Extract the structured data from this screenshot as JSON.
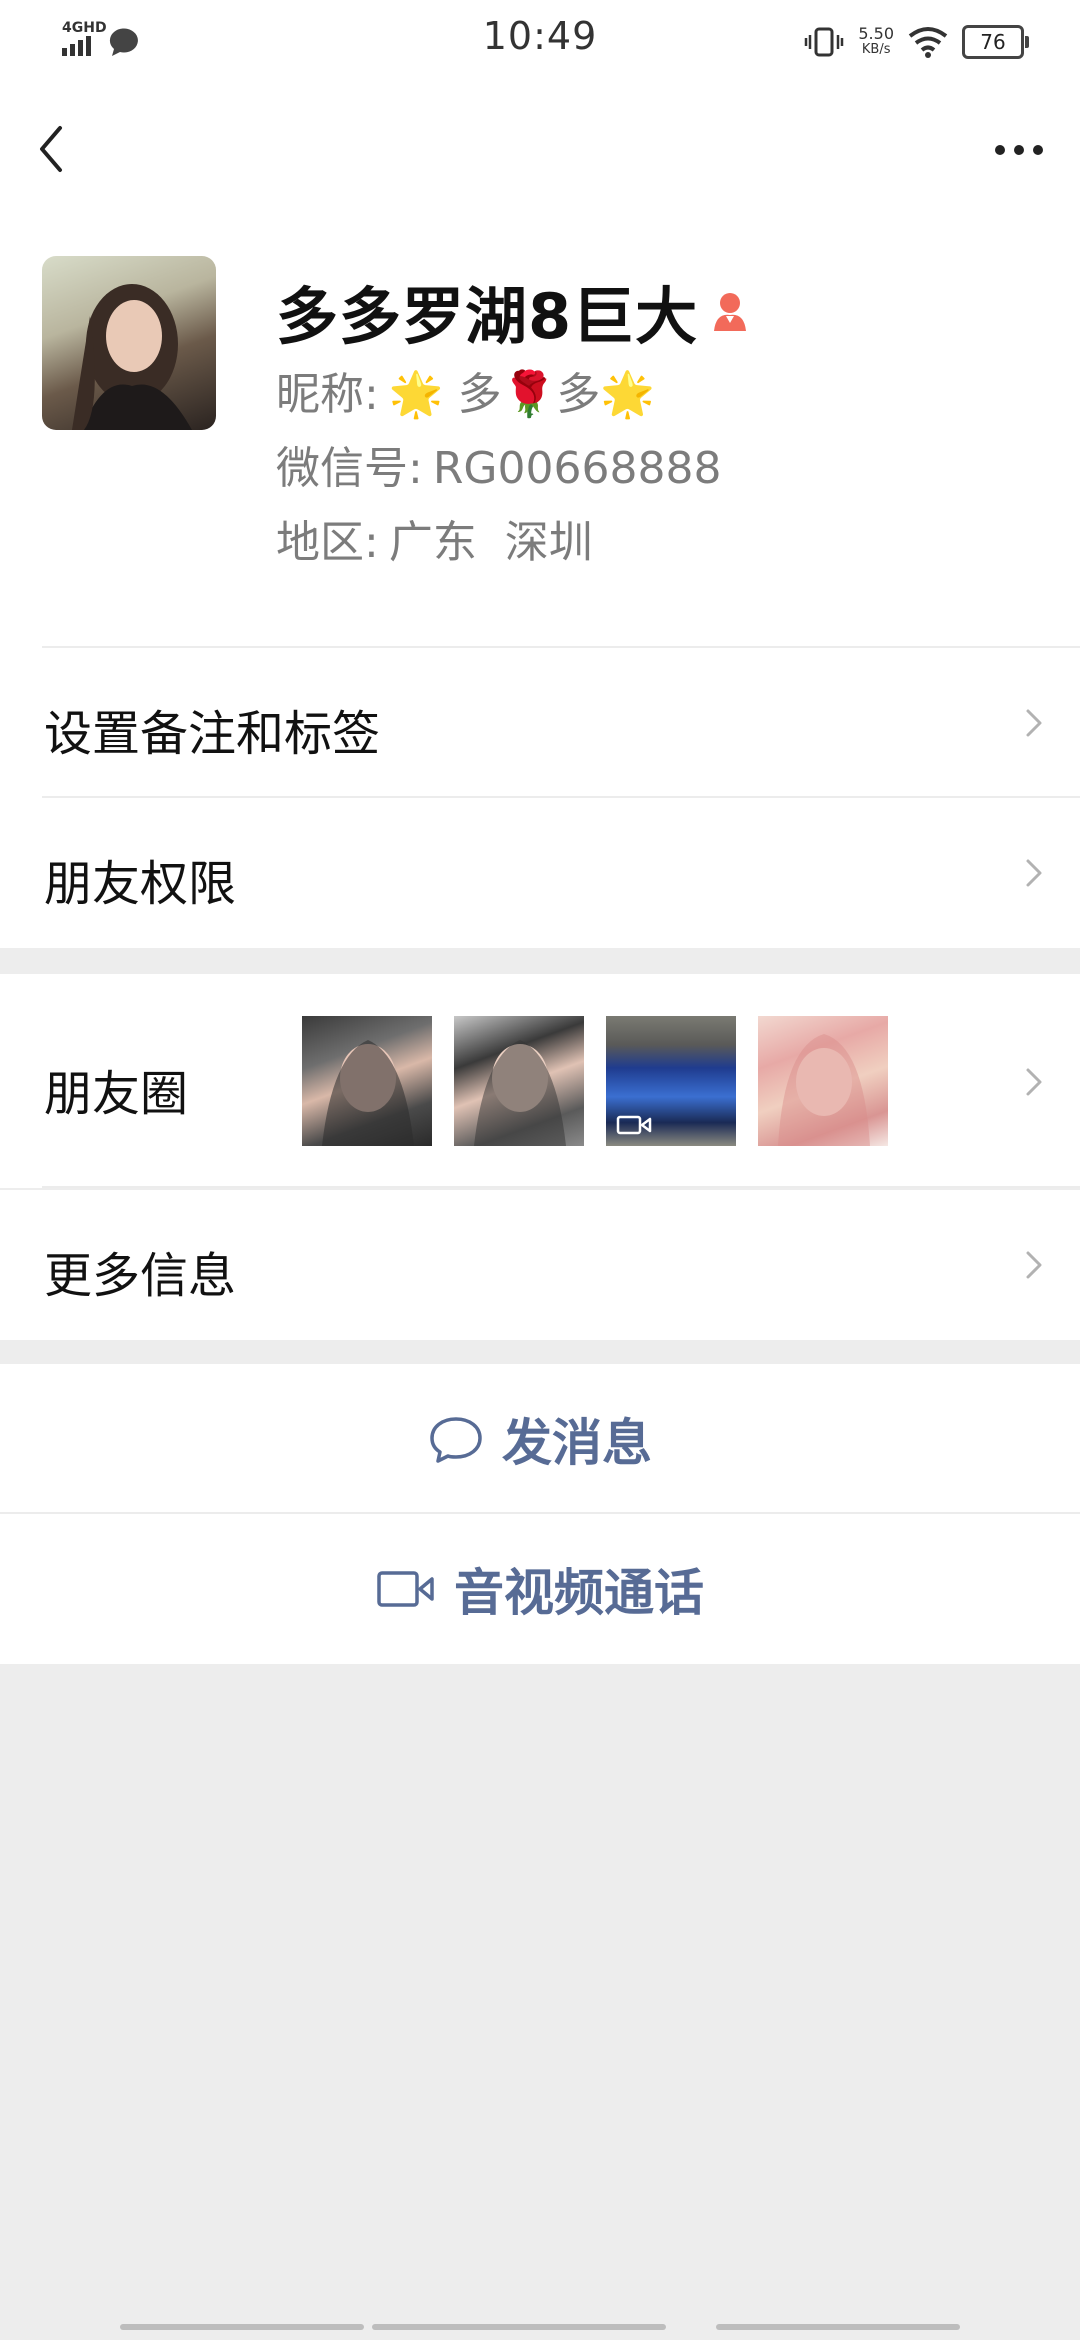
{
  "status_bar": {
    "network": "4GHD",
    "time": "10:49",
    "speed_value": "5.50",
    "speed_unit": "KB/s",
    "battery": "76"
  },
  "nav": {
    "back_icon": "chevron-left-icon",
    "more_icon": "more-dots-icon"
  },
  "profile": {
    "name": "多多罗湖8巨大",
    "gender_icon": "female-gender-icon",
    "nickname_label": "昵称:",
    "nickname_value": "🌟 多🌹多🌟",
    "wechat_id_label": "微信号:",
    "wechat_id_value": "RG00668888",
    "region_label": "地区:",
    "region_value": "广东  深圳"
  },
  "menu": {
    "remark_tags": "设置备注和标签",
    "friend_permissions": "朋友权限",
    "moments": "朋友圈",
    "more_info": "更多信息"
  },
  "actions": {
    "message": "发消息",
    "video_call": "音视频通话"
  },
  "colors": {
    "link_blue": "#576b95",
    "background": "#ededed",
    "female_icon": "#f26a5a"
  }
}
